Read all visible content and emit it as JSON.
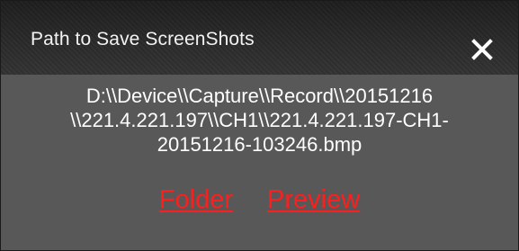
{
  "dialog": {
    "title": "Path to Save ScreenShots",
    "close_icon": "close-icon",
    "path_lines": [
      "D:\\\\Device\\\\Capture\\\\Record\\\\20151216",
      "\\\\221.4.221.197\\\\CH1\\\\221.4.221.197-CH1-",
      "20151216-103246.bmp"
    ],
    "folder_label": "Folder",
    "preview_label": "Preview"
  },
  "colors": {
    "dialog_background": "#585858",
    "titlebar_background": "#262626",
    "text": "#ffffff",
    "link": "#ff1e1e"
  }
}
